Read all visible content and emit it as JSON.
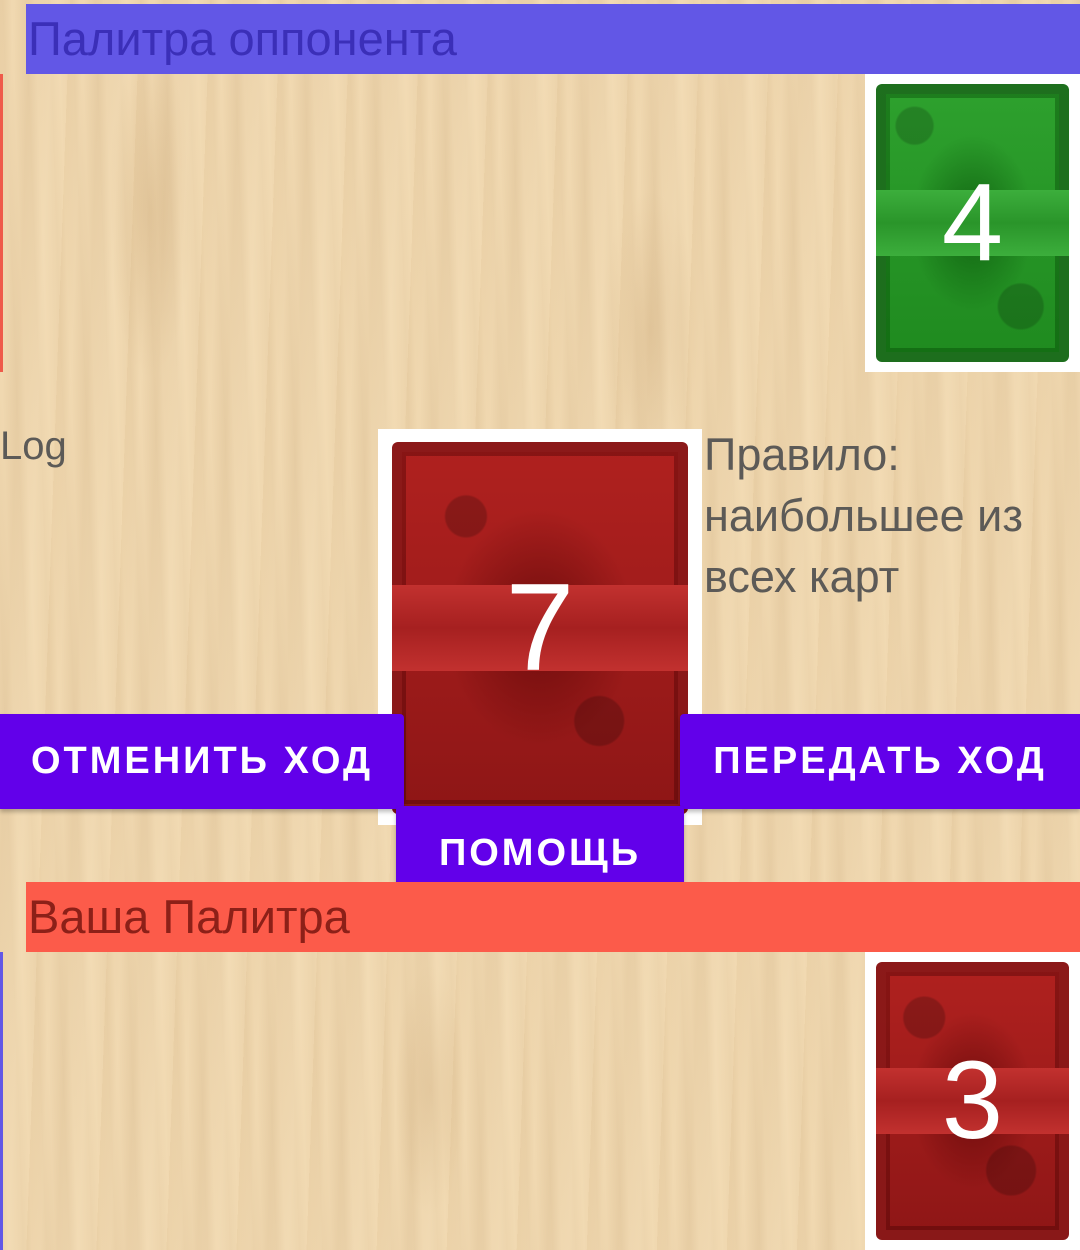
{
  "opponent_palette": {
    "title": "Палитра оппонента",
    "color": "#6257e6"
  },
  "your_palette": {
    "title": "Ваша Палитра",
    "color": "#fc5b4a"
  },
  "log": {
    "label": "Log"
  },
  "rule": {
    "text": "Правило: наибольшее из всех карт"
  },
  "cards": {
    "opponent_palette_card": {
      "value": "4",
      "color": "green"
    },
    "center_card": {
      "value": "7",
      "color": "red"
    },
    "your_palette_card": {
      "value": "3",
      "color": "red"
    }
  },
  "buttons": {
    "undo": "ОТМЕНИТЬ ХОД",
    "pass": "ПЕРЕДАТЬ ХОД",
    "help": "ПОМОЩЬ"
  },
  "colors": {
    "button": "#6200ea",
    "table": "#f1d9b1"
  }
}
